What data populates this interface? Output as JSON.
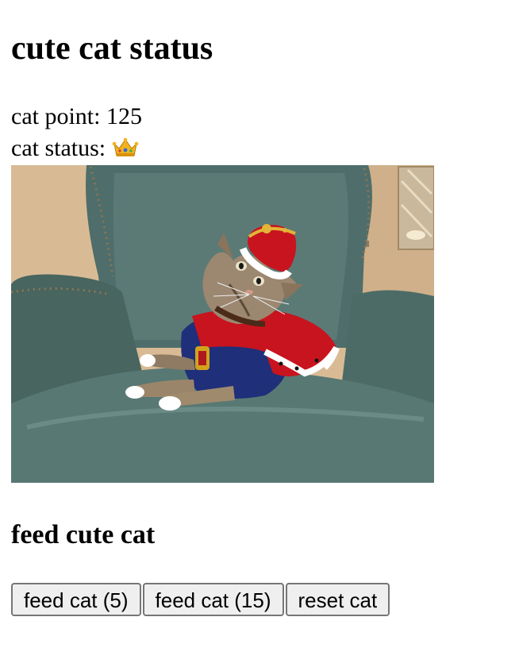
{
  "header": {
    "title": "cute cat status"
  },
  "stats": {
    "point_label": "cat point: ",
    "point_value": "125",
    "status_label": "cat status: ",
    "status_icon": "crown-icon"
  },
  "photo": {
    "subject": "cat-in-crown-and-cape-on-armchair"
  },
  "feed": {
    "heading": "feed cute cat",
    "buttons": [
      {
        "label": "feed cat (5)"
      },
      {
        "label": "feed cat (15)"
      },
      {
        "label": "reset cat"
      }
    ]
  }
}
